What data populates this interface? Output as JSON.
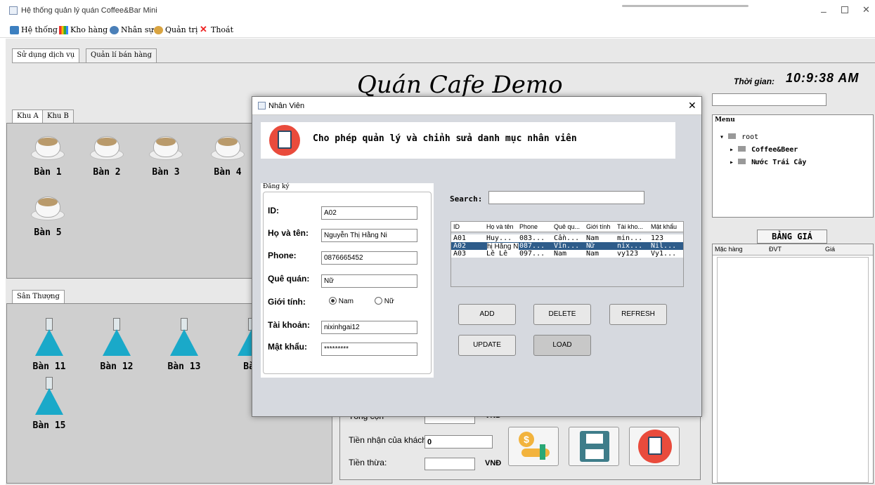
{
  "window": {
    "title": "Hệ thống quản lý quán Coffee&Bar Mini"
  },
  "menubar": [
    {
      "label": "Hệ thống",
      "icon": "edit-icon"
    },
    {
      "label": "Kho hàng",
      "icon": "bar-chart-icon"
    },
    {
      "label": "Nhân sự",
      "icon": "staff-icon"
    },
    {
      "label": "Quản trị",
      "icon": "admin-icon"
    },
    {
      "label": "Thoát",
      "icon": "close-x-icon"
    }
  ],
  "main_tabs": [
    "Sử dụng dịch vụ",
    "Quản lí bán hàng"
  ],
  "shop_title": "Quán Cafe Demo",
  "time": {
    "label": "Thời gian:",
    "value": "10:9:38 AM"
  },
  "zone_tabs": [
    "Khu A",
    "Khu B"
  ],
  "zone_a_tables": [
    "Bàn 1",
    "Bàn 2",
    "Bàn 3",
    "Bàn 4",
    "Bàn 5"
  ],
  "rooftop_tab": "Sân Thượng",
  "rooftop_tables": [
    "Bàn 11",
    "Bàn 12",
    "Bàn 13",
    "Bàn",
    "Bàn 15"
  ],
  "menu_tree": {
    "title": "Menu",
    "root": "root",
    "children": [
      "Coffee&Beer",
      "Nước Trái Cây"
    ]
  },
  "price_board": {
    "title": "BẢNG GIÁ",
    "columns": [
      "Mặc hàng",
      "ĐVT",
      "Giá"
    ]
  },
  "payment": {
    "total_label_partial": "Tổng cộn",
    "unit": "VNĐ",
    "received_label": "Tiền nhận của khách:",
    "received_value": "0",
    "change_label": "Tiền thừa:",
    "change_unit": "VNĐ"
  },
  "dialog": {
    "title": "Nhân Viên",
    "banner": "Cho phép quản lý và chỉnh sửa danh mục nhân viên",
    "group_title": "Đăng ký",
    "fields": {
      "id": {
        "label": "ID:",
        "value": "A02"
      },
      "name": {
        "label": "Họ và tên:",
        "value": "Nguyễn Thị Hằng Ni"
      },
      "phone": {
        "label": "Phone:",
        "value": "0876665452"
      },
      "hometown": {
        "label": "Quê quán:",
        "value": "Nữ"
      },
      "gender": {
        "label": "Giới tính:",
        "options": [
          "Nam",
          "Nữ"
        ],
        "selected": "Nam"
      },
      "account": {
        "label": "Tài khoản:",
        "value": "nixinhgai12"
      },
      "password": {
        "label": "Mật khẩu:",
        "value": "*********"
      }
    },
    "search_label": "Search:",
    "grid": {
      "columns": [
        "ID",
        "Họ và tên",
        "Phone",
        "Quê qu...",
        "Giới tính",
        "Tài kho...",
        "Mật khẩu"
      ],
      "rows": [
        [
          "A01",
          "Huy...",
          "083...",
          "Cần...",
          "Nam",
          "min...",
          "123"
        ],
        [
          "A02",
          "hị Hằng Ni",
          "087...",
          "Vĩn...",
          "Nữ",
          "nix...",
          "Nil..."
        ],
        [
          "A03",
          "Lê Lê",
          "097...",
          "Nam",
          "Nam",
          "vy123",
          "Vy1..."
        ]
      ],
      "selected_row": 1
    },
    "buttons": {
      "add": "ADD",
      "delete": "DELETE",
      "refresh": "REFRESH",
      "update": "UPDATE",
      "load": "LOAD"
    }
  },
  "colors": {
    "accent": "#2e5c8a",
    "banner_icon": "#e94b3c",
    "flask": "#1aa9c9"
  }
}
